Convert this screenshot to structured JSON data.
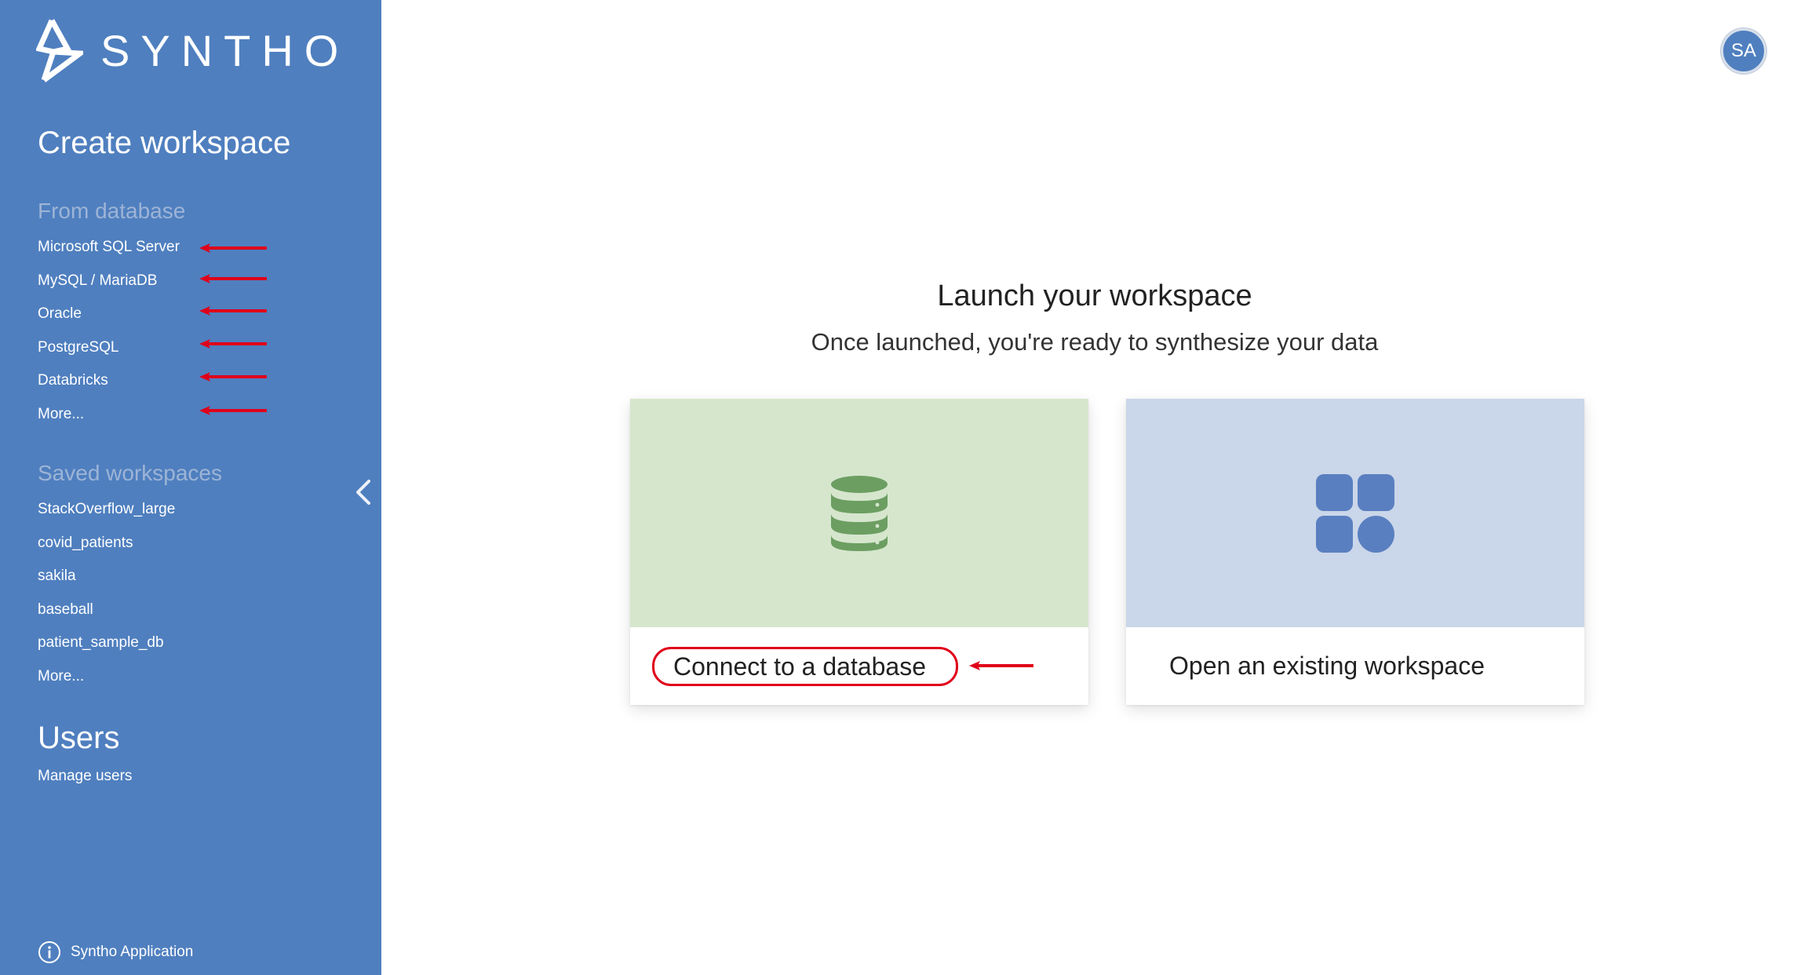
{
  "app": {
    "brand": "SYNTHO",
    "brand_color": "#4f7fbf",
    "annotation_color": "#e0001a"
  },
  "sidebar": {
    "title": "Create workspace",
    "from_database": {
      "heading": "From database",
      "items": [
        "Microsoft SQL Server",
        "MySQL / MariaDB",
        "Oracle",
        "PostgreSQL",
        "Databricks",
        "More..."
      ]
    },
    "saved_workspaces": {
      "heading": "Saved workspaces",
      "items": [
        "StackOverflow_large",
        "covid_patients",
        "sakila",
        "baseball",
        "patient_sample_db",
        "More..."
      ]
    },
    "users": {
      "heading": "Users",
      "items": [
        "Manage users"
      ]
    },
    "footer": {
      "icon": "info-icon",
      "label": "Syntho Application"
    },
    "collapse_icon": "chevron-left-icon"
  },
  "header": {
    "avatar_initials": "SA"
  },
  "main": {
    "title": "Launch your workspace",
    "subtitle": "Once launched, you're ready to synthesize your data",
    "cards": [
      {
        "label": "Connect to a database",
        "icon": "database-icon",
        "bg": "#d6e6cd",
        "icon_color": "#6c9e61"
      },
      {
        "label": "Open an existing workspace",
        "icon": "workspace-grid-icon",
        "bg": "#cad6e9",
        "icon_color": "#5a7fc0"
      }
    ]
  }
}
